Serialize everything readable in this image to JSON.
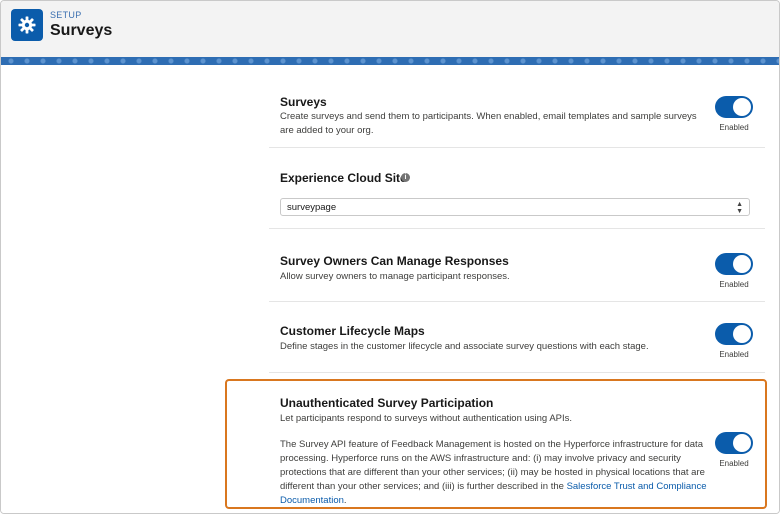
{
  "header": {
    "eyebrow": "SETUP",
    "title": "Surveys",
    "icon": "gear-icon"
  },
  "sections": [
    {
      "title": "Surveys",
      "description": "Create surveys and send them to participants. When enabled, email templates and sample surveys are added to your org.",
      "toggle_label": "Enabled"
    },
    {
      "title": "Experience Cloud Site",
      "select_value": "surveypage"
    },
    {
      "title": "Survey Owners Can Manage Responses",
      "description": "Allow survey owners to manage participant responses.",
      "toggle_label": "Enabled"
    },
    {
      "title": "Customer Lifecycle Maps",
      "description": "Define stages in the customer lifecycle and associate survey questions with each stage.",
      "toggle_label": "Enabled"
    },
    {
      "title": "Unauthenticated Survey Participation",
      "description": "Let participants respond to surveys without authentication using APIs.",
      "body": "The Survey API feature of Feedback Management is hosted on the Hyperforce infrastructure for data processing. Hyperforce runs on the AWS infrastructure and: (i) may involve privacy and security protections that are different than your other services; (ii) may be hosted in physical locations that are different than your other services; and (iii) is further described in the",
      "link_text": "Salesforce Trust and Compliance Documentation",
      "body_end": ".",
      "toggle_label": "Enabled"
    }
  ],
  "colors": {
    "accent": "#0b5cab",
    "highlight": "#d9771f"
  }
}
